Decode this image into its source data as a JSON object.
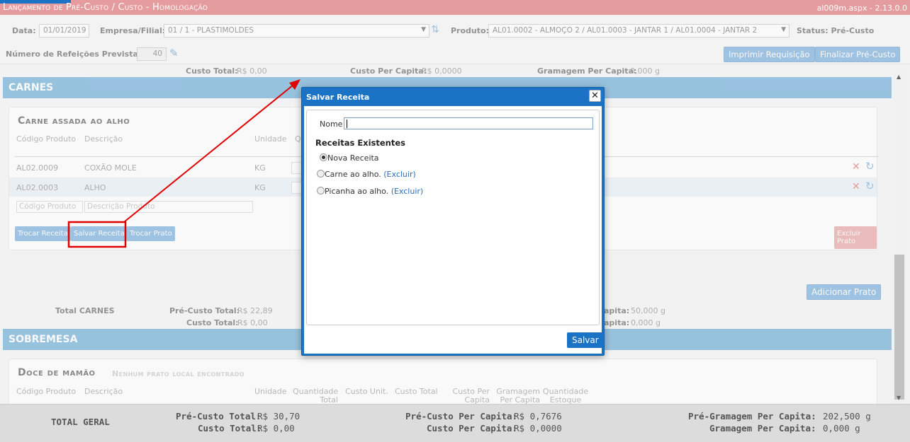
{
  "titlebar": {
    "title": "Lançamento de Pré-Custo / Custo  - Homologação",
    "version": "al009m.aspx - 2.13.0.0"
  },
  "form": {
    "data_label": "Data:",
    "data_value": "01/01/2019",
    "empresa_label": "Empresa/Filial:",
    "empresa_value": "01 / 1 - PLASTIMOLDES",
    "produto_label": "Produto:",
    "produto_value": "AL01.0002 - ALMOÇO 2 / AL01.0003 - JANTAR 1 / AL01.0004 - JANTAR 2",
    "status_label": "Status:",
    "status_value": "Pré-Custo",
    "refeicoes_label": "Número de Refeições Previstas:",
    "refeicoes_value": "40",
    "imprimir_label": "Imprimir Requisição",
    "finalizar_label": "Finalizar Pré-Custo"
  },
  "top_partial": {
    "custo_total": "Custo Total:",
    "custo_total_val": "R$ 0,00",
    "custo_pc": "Custo Per Capita:",
    "custo_pc_val": "R$ 0,0000",
    "gram_pc": "Gramagem Per Capita:",
    "gram_pc_val": "0,000 g"
  },
  "carnes": {
    "header": "CARNES",
    "dish": "Carne assada ao alho",
    "columns": [
      "Código Produto",
      "Descrição",
      "Unidade",
      "Q"
    ],
    "rows": [
      {
        "code": "AL02.0009",
        "desc": "COXÃO MOLE",
        "unit": "KG"
      },
      {
        "code": "AL02.0003",
        "desc": "ALHO",
        "unit": "KG"
      }
    ],
    "code_placeholder": "Código Produto",
    "desc_placeholder": "Descrição Produto",
    "buttons": {
      "trocar_receita": "Trocar Receita",
      "salvar_receita": "Salvar Receita",
      "trocar_prato": "Trocar Prato",
      "excluir_prato": "Excluir Prato"
    },
    "adicionar_prato": "Adicionar Prato",
    "total_label": "Total CARNES",
    "pre_custo_total": "Pré-Custo Total:",
    "pre_custo_total_val": "R$ 22,89",
    "custo_total": "Custo Total:",
    "custo_total_val": "R$ 0,00",
    "pc1": "apita:",
    "pc1_val": "50,000 g",
    "pc2": "apita:",
    "pc2_val": "0,000 g"
  },
  "sobremesa": {
    "header": "SOBREMESA",
    "dish": "Doce de mamão",
    "dish_sub": "Nenhum prato local encontrado",
    "columns": [
      "Código Produto",
      "Descrição",
      "Unidade",
      "Quantidade Total",
      "Custo Unit.",
      "Custo Total",
      "Custo Per Capita",
      "Gramagem Per Capita",
      "Quantidade Estoque"
    ]
  },
  "bottom": {
    "total_geral": "TOTAL GERAL",
    "pre_custo_total": "Pré-Custo Total:",
    "pre_custo_total_val": "R$ 30,70",
    "custo_total": "Custo Total:",
    "custo_total_val": "R$ 0,00",
    "pre_custo_pc": "Pré-Custo Per Capita:",
    "pre_custo_pc_val": "R$ 0,7676",
    "custo_pc": "Custo Per Capita:",
    "custo_pc_val": "R$ 0,0000",
    "pre_gram_pc": "Pré-Gramagem Per Capita:",
    "pre_gram_pc_val": "202,500 g",
    "gram_pc": "Gramagem Per Capita:",
    "gram_pc_val": "0,000 g"
  },
  "modal": {
    "title": "Salvar Receita",
    "nome_label": "Nome",
    "nome_value": "",
    "existing_heading": "Receitas Existentes",
    "options": [
      {
        "label": "Nova Receita",
        "checked": true,
        "delete": ""
      },
      {
        "label": "Carne ao alho.",
        "checked": false,
        "delete": "(Excluir)"
      },
      {
        "label": "Picanha ao alho.",
        "checked": false,
        "delete": "(Excluir)"
      }
    ],
    "save_label": "Salvar"
  },
  "colors": {
    "accent": "#1a73c4",
    "section": "#4e9bcf",
    "annotation": "#e00000",
    "titlebar": "#e49c9e"
  },
  "icons": [
    "sync-icon",
    "pencil-icon",
    "close-icon",
    "delete-x-icon",
    "refresh-icon",
    "annotation-arrow"
  ]
}
